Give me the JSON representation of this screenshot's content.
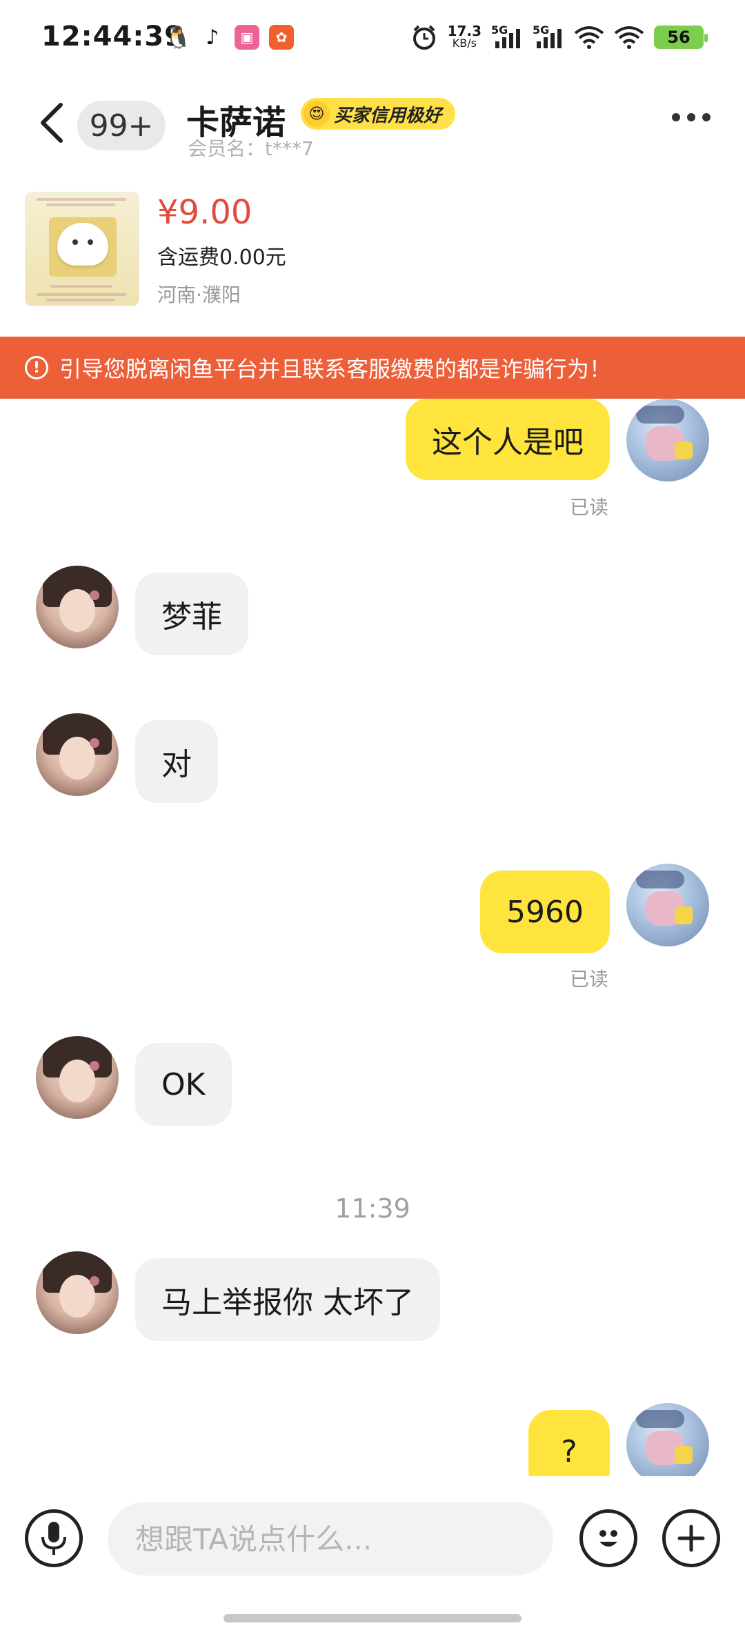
{
  "status_bar": {
    "time": "12:44:39",
    "net_speed_value": "17.3",
    "net_speed_unit": "KB/s",
    "sim1": "5G",
    "sim2": "5G",
    "battery": "56",
    "app_icons": [
      "qq-icon",
      "tiktok-icon",
      "bilibili-icon",
      "app-orange-icon"
    ]
  },
  "header": {
    "unread_count": "99+",
    "contact_name": "卡萨诺",
    "credit_badge": "买家信用极好",
    "member_label": "会员名：t***7"
  },
  "product": {
    "price": "¥9.00",
    "shipping": "含运费0.00元",
    "location": "河南·濮阳"
  },
  "warning": {
    "text": "引导您脱离闲鱼平台并且联系客服缴费的都是诈骗行为！"
  },
  "messages": [
    {
      "side": "me",
      "text": "这个人是吧",
      "status": "已读"
    },
    {
      "side": "other",
      "text": "梦菲"
    },
    {
      "side": "other",
      "text": "对"
    },
    {
      "side": "me",
      "text": "5960",
      "status": "已读"
    },
    {
      "side": "other",
      "text": "OK"
    },
    {
      "side": "other",
      "text": "马上举报你 太坏了"
    },
    {
      "side": "me",
      "text": "?"
    }
  ],
  "time_divider": "11:39",
  "input": {
    "placeholder": "想跟TA说点什么..."
  },
  "colors": {
    "accent_yellow": "#ffe43d",
    "warning_orange": "#ec5f38",
    "price_red": "#e24a3b",
    "battery_green": "#7ccd4c"
  }
}
